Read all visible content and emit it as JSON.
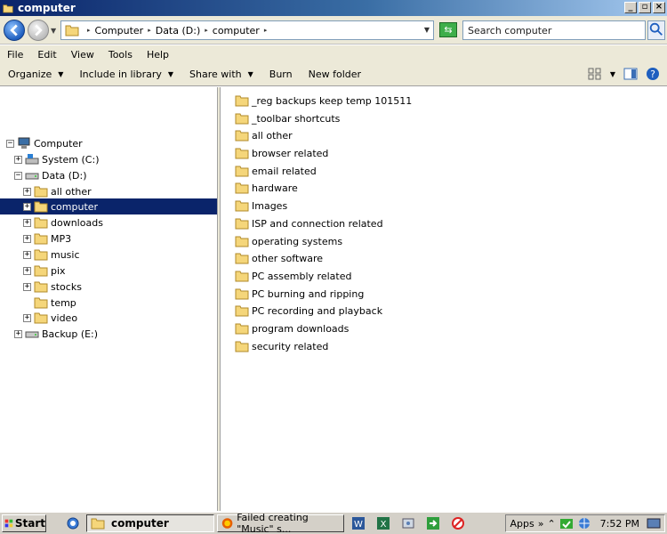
{
  "window": {
    "title": "computer"
  },
  "address": {
    "crumbs": [
      "Computer",
      "Data (D:)",
      "computer"
    ]
  },
  "search": {
    "placeholder": "Search computer"
  },
  "menu": {
    "file": "File",
    "edit": "Edit",
    "view": "View",
    "tools": "Tools",
    "help": "Help"
  },
  "commands": {
    "organize": "Organize",
    "include": "Include in library",
    "share": "Share with",
    "burn": "Burn",
    "new_folder": "New folder"
  },
  "tree": {
    "computer": "Computer",
    "system": "System (C:)",
    "data": "Data (D:)",
    "all_other": "all other",
    "computer_folder": "computer",
    "downloads": "downloads",
    "mp3": "MP3",
    "music": "music",
    "pix": "pix",
    "stocks": "stocks",
    "temp": "temp",
    "video": "video",
    "backup": "Backup (E:)"
  },
  "files": [
    "_reg backups keep temp 101511",
    "_toolbar shortcuts",
    "all other",
    "browser related",
    "email related",
    "hardware",
    "Images",
    "ISP and connection related",
    "operating systems",
    "other software",
    "PC assembly related",
    "PC burning and ripping",
    "PC recording and playback",
    "program downloads",
    "security related"
  ],
  "taskbar": {
    "start": "Start",
    "active_task": "computer",
    "task2": "Failed creating \"Music\" s...",
    "apps": "Apps",
    "time": "7:52 PM"
  },
  "colors": {
    "selection": "#0a246a",
    "titlebar": "#0a246a",
    "folder": "#f5d67a"
  }
}
